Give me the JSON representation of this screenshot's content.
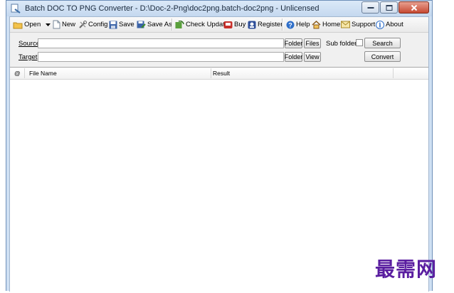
{
  "window": {
    "title": "Batch DOC TO PNG Converter - D:\\Doc-2-Png\\doc2png.batch-doc2png - Unlicensed"
  },
  "toolbar": {
    "open": "Open",
    "new": "New",
    "config": "Config",
    "save": "Save",
    "save_as": "Save As",
    "check_update": "Check Update",
    "buy": "Buy",
    "register": "Register",
    "help": "Help",
    "home": "Home",
    "support": "Support",
    "about": "About"
  },
  "form": {
    "source_label": "Source",
    "target_label": "Target",
    "source_value": "",
    "target_value": "",
    "folder_button": "Folder",
    "files_button": "Files",
    "view_button": "View",
    "subfolders_label": "Sub folders",
    "subfolders_checked": false,
    "search_button": "Search",
    "convert_button": "Convert"
  },
  "list": {
    "columns": [
      "@",
      "File Name",
      "Result"
    ],
    "rows": []
  },
  "watermark": "最需网"
}
